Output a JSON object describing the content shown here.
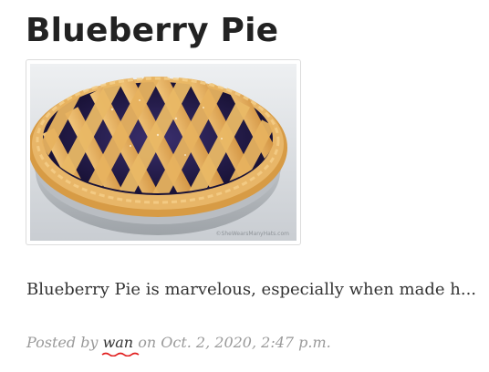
{
  "post": {
    "title": "Blueberry Pie",
    "image_watermark": "©SheWearsManyHats.com",
    "excerpt": "Blueberry Pie is marvelous, especially when made h...",
    "meta": {
      "posted_by_label": "Posted by",
      "author": "wan",
      "on_label": "on",
      "date": "Oct. 2, 2020, 2:47 p.m."
    }
  },
  "colors": {
    "title": "#222222",
    "meta_text": "#9a9a9a",
    "author_link": "#333333",
    "spellcheck_underline": "#e11d1d"
  }
}
